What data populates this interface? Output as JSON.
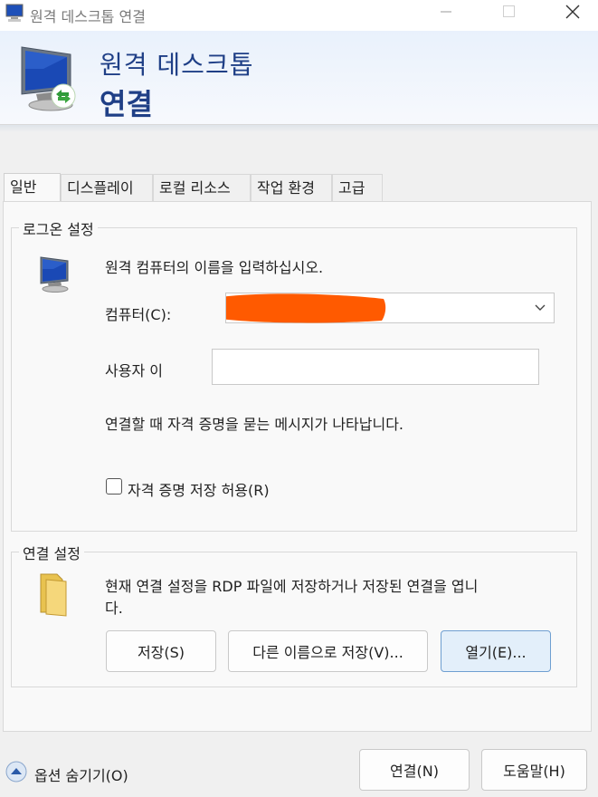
{
  "window": {
    "title": "원격 데스크톱 연결",
    "minimize_icon": "minimize-icon",
    "maximize_icon": "maximize-icon",
    "close_icon": "close-icon"
  },
  "banner": {
    "line1": "원격 데스크톱",
    "line2": "연결",
    "icon": "remote-monitor-icon"
  },
  "tabs": [
    {
      "label": "일반"
    },
    {
      "label": "디스플레이"
    },
    {
      "label": "로컬 리소스"
    },
    {
      "label": "작업 환경"
    },
    {
      "label": "고급"
    }
  ],
  "logon": {
    "group_label": "로그온 설정",
    "instruction": "원격 컴퓨터의 이름을 입력하십시오.",
    "computer_label": "컴퓨터(C):",
    "computer_value": "",
    "username_label": "사용자 이",
    "username_value": "",
    "prompt_text": "연결할 때 자격 증명을 묻는 메시지가 나타납니다.",
    "save_credentials_label": "자격 증명 저장 허용(R)",
    "save_credentials_checked": false
  },
  "connection": {
    "group_label": "연결 설정",
    "description_line1": "현재 연결 설정을 RDP 파일에 저장하거나 저장된 연결을 엽니",
    "description_line2": "다.",
    "save_label": "저장(S)",
    "save_as_label": "다른 이름으로 저장(V)...",
    "open_label": "열기(E)..."
  },
  "footer": {
    "options_label": "옵션 숨기기(O)",
    "connect_label": "연결(N)",
    "help_label": "도움말(H)"
  },
  "colors": {
    "banner_text": "#1f3f86",
    "redaction": "#ff5a00",
    "accent_button": "#e3effa"
  }
}
